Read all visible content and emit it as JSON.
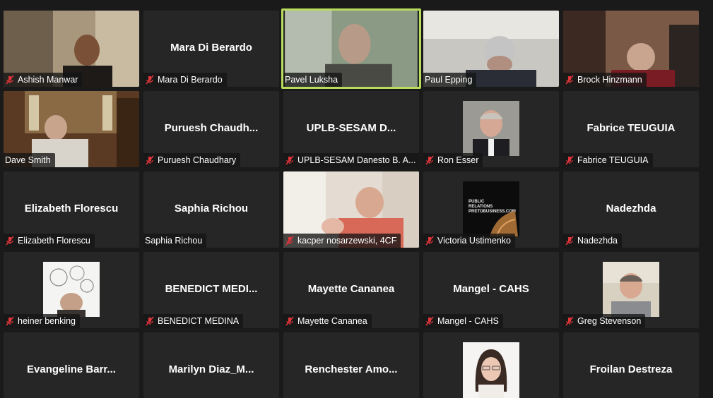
{
  "participants": [
    {
      "id": "p1",
      "label": "Ashish Manwar",
      "center": "",
      "muted": true
    },
    {
      "id": "p2",
      "label": "Mara Di Berardo",
      "center": "Mara Di Berardo",
      "muted": true
    },
    {
      "id": "p3",
      "label": "Pavel Luksha",
      "center": "",
      "muted": false,
      "active": true
    },
    {
      "id": "p4",
      "label": "Paul Epping",
      "center": "",
      "muted": false
    },
    {
      "id": "p5",
      "label": "Brock Hinzmann",
      "center": "",
      "muted": true
    },
    {
      "id": "p6",
      "label": "Dave Smith",
      "center": "",
      "muted": false
    },
    {
      "id": "p7",
      "label": "Puruesh Chaudhary",
      "center": "Puruesh  Chaudh...",
      "muted": true
    },
    {
      "id": "p8",
      "label": "UPLB-SESAM Danesto B. A...",
      "center": "UPLB-SESAM  D...",
      "muted": true
    },
    {
      "id": "p9",
      "label": "Ron Esser",
      "center": "",
      "muted": true
    },
    {
      "id": "p10",
      "label": "Fabrice TEUGUIA",
      "center": "Fabrice TEUGUIA",
      "muted": true
    },
    {
      "id": "p11",
      "label": "Elizabeth Florescu",
      "center": "Elizabeth Florescu",
      "muted": true
    },
    {
      "id": "p12",
      "label": "Saphia Richou",
      "center": "Saphia Richou",
      "muted": false
    },
    {
      "id": "p13",
      "label": "kacper nosarzewski, 4CF",
      "center": "",
      "muted": true
    },
    {
      "id": "p14",
      "label": "Victoria Ustimenko",
      "center": "",
      "muted": true
    },
    {
      "id": "p15",
      "label": "Nadezhda",
      "center": "Nadezhda",
      "muted": true
    },
    {
      "id": "p16",
      "label": "heiner benking",
      "center": "",
      "muted": true
    },
    {
      "id": "p17",
      "label": "BENEDICT MEDINA",
      "center": "BENEDICT  MEDI...",
      "muted": true
    },
    {
      "id": "p18",
      "label": "Mayette Cananea",
      "center": "Mayette Cananea",
      "muted": true
    },
    {
      "id": "p19",
      "label": "Mangel - CAHS",
      "center": "Mangel - CAHS",
      "muted": true
    },
    {
      "id": "p20",
      "label": "Greg Stevenson",
      "center": "",
      "muted": true
    },
    {
      "id": "p21",
      "label": "",
      "center": "Evangeline  Barr...",
      "muted": false
    },
    {
      "id": "p22",
      "label": "",
      "center": "Marilyn  Diaz_M...",
      "muted": false
    },
    {
      "id": "p23",
      "label": "",
      "center": "Renchester  Amo...",
      "muted": false
    },
    {
      "id": "p24",
      "label": "",
      "center": "",
      "muted": false
    },
    {
      "id": "p25",
      "label": "",
      "center": "Froilan Destreza",
      "muted": false
    }
  ],
  "thumb_text": {
    "victoria": "PUBLIC RELATIONS PRETOBUSINESS.COM"
  },
  "colors": {
    "active_border": "#b9dc5d",
    "mute_red": "#e0353b",
    "tile_bg": "#262626"
  }
}
